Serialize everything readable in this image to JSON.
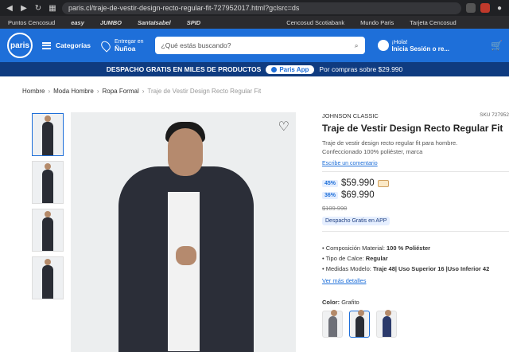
{
  "browser": {
    "url": "paris.cl/traje-de-vestir-design-recto-regular-fit-727952017.html?gclsrc=ds",
    "bookmarks": [
      "Puntos Cencosud",
      "easy",
      "JUMBO",
      "SantaIsabel",
      "SPID",
      "Cencosud Scotiabank",
      "Mundo Paris",
      "Tarjeta Cencosud"
    ]
  },
  "header": {
    "logo_text": "paris",
    "categories_label": "Categorías",
    "delivery_line1": "Entregar en",
    "delivery_line2": "Ñuñoa",
    "search_placeholder": "¿Qué estás buscando?",
    "user_greeting": "¡Hola!",
    "user_login": "Inicia Sesión o re..."
  },
  "promo": {
    "text": "DESPACHO GRATIS EN MILES DE PRODUCTOS",
    "pill_label": "Paris App",
    "sub": "Por compras sobre $29.990"
  },
  "breadcrumb": {
    "items": [
      "Hombre",
      "Moda Hombre",
      "Ropa Formal"
    ],
    "current": "Traje de Vestir Design Recto Regular Fit"
  },
  "product": {
    "brand": "JOHNSON CLASSIC",
    "sku": "SKU 727952",
    "title": "Traje de Vestir Design Recto Regular Fit",
    "description": "Traje de vestir design recto regular fit para hombre. Confeccionado 100% poliéster, marca",
    "review_link": "Escribe un comentario",
    "prices": [
      {
        "discount": "45%",
        "price": "$59.990"
      },
      {
        "discount": "36%",
        "price": "$69.990"
      }
    ],
    "old_price": "$109.990",
    "badge": "Despacho Gratis en APP",
    "specs": [
      {
        "label": "Composición Material:",
        "value": "100 % Poliéster"
      },
      {
        "label": "Tipo de Calce:",
        "value": "Regular"
      },
      {
        "label": "Medidas Modelo:",
        "value": "Traje 48| Uso Superior 16 |Uso Inferior 42"
      }
    ],
    "more_link": "Ver más detalles",
    "color_label": "Color:",
    "color_value": "Grafito"
  }
}
